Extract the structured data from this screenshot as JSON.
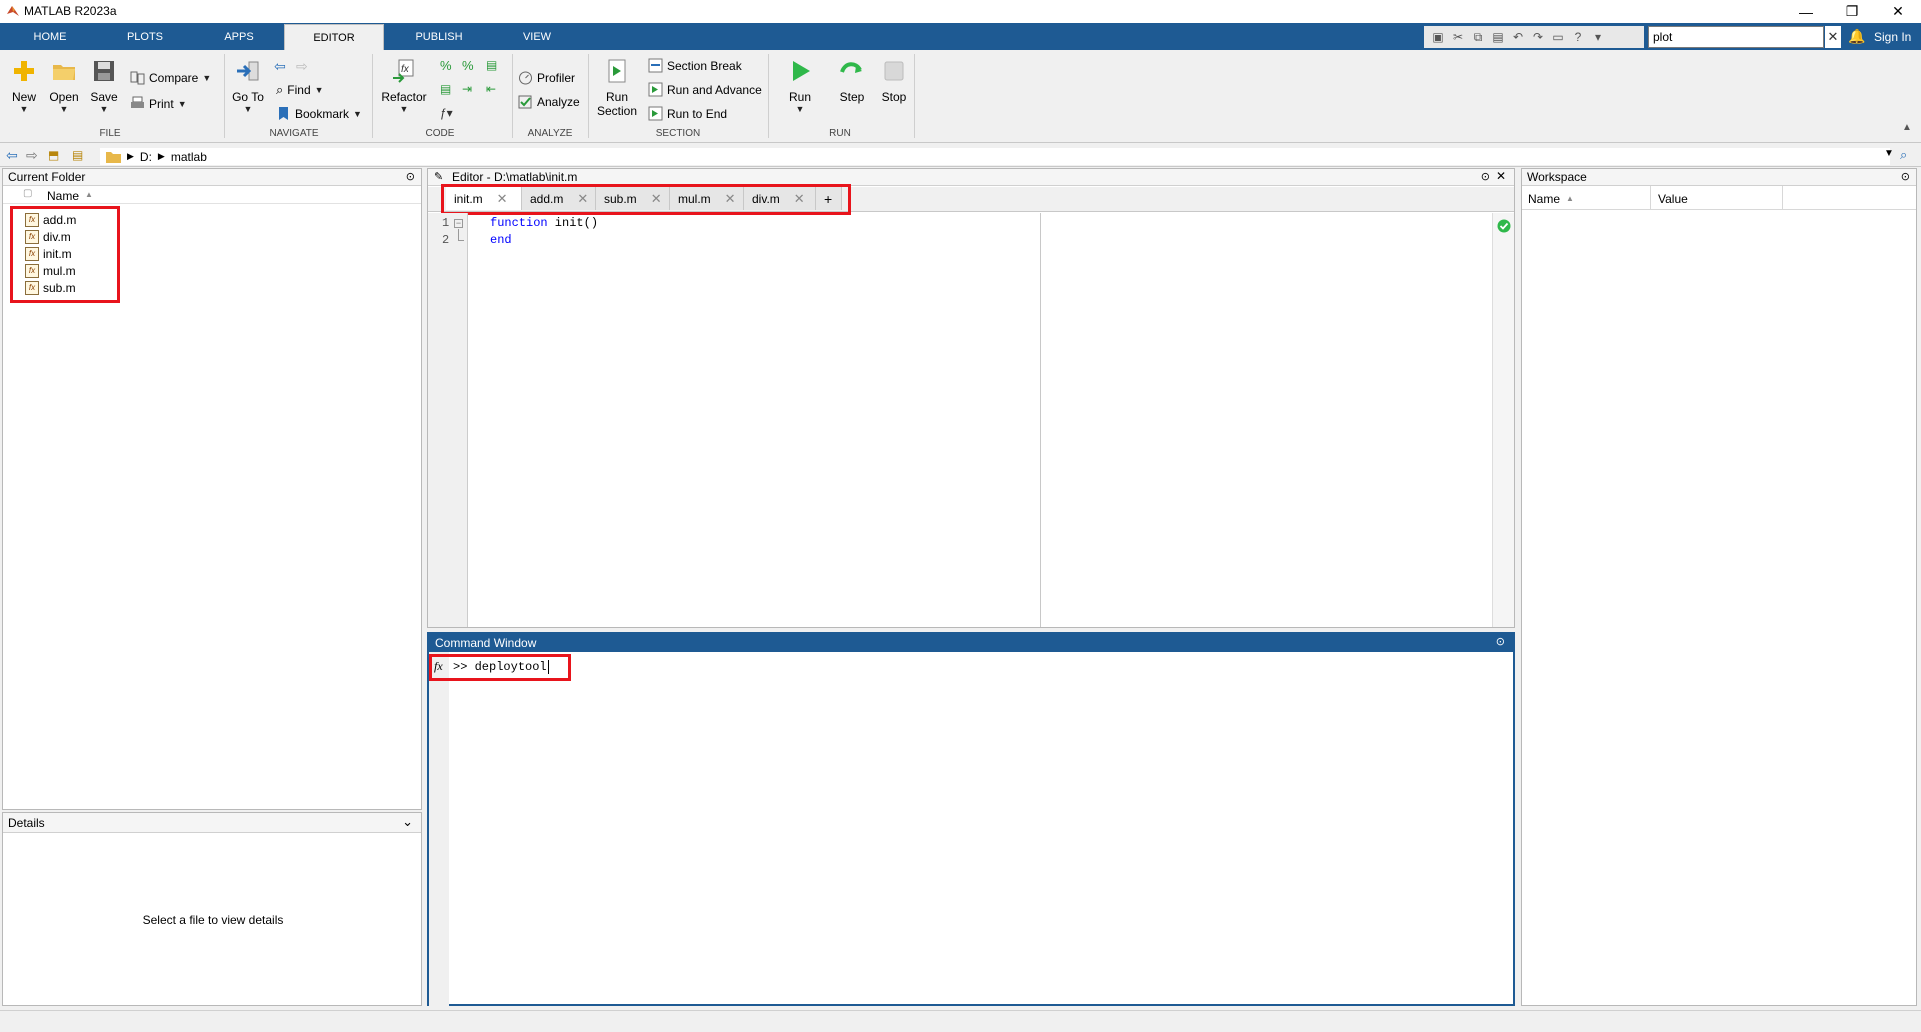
{
  "window": {
    "title": "MATLAB R2023a",
    "minimize": "—",
    "restore": "❐",
    "close": "✕"
  },
  "ribbon_tabs": [
    "HOME",
    "PLOTS",
    "APPS",
    "EDITOR",
    "PUBLISH",
    "VIEW"
  ],
  "active_tab": "EDITOR",
  "search": {
    "value": "plot",
    "clear": "✕"
  },
  "sign_in": "Sign In",
  "toolstrip": {
    "file": {
      "label": "FILE",
      "new": "New",
      "open": "Open",
      "save": "Save",
      "compare": "Compare",
      "print": "Print"
    },
    "navigate": {
      "label": "NAVIGATE",
      "go_to": "Go To",
      "find": "Find",
      "bookmark": "Bookmark"
    },
    "code": {
      "label": "CODE",
      "refactor": "Refactor"
    },
    "analyze": {
      "label": "ANALYZE",
      "profiler": "Profiler",
      "analyze": "Analyze"
    },
    "section": {
      "label": "SECTION",
      "run_section_1": "Run",
      "run_section_2": "Section",
      "section_break": "Section Break",
      "run_and_advance": "Run and Advance",
      "run_to_end": "Run to End"
    },
    "run": {
      "label": "RUN",
      "run": "Run",
      "step": "Step",
      "stop": "Stop"
    }
  },
  "address": {
    "drive": "D:",
    "folder": "matlab"
  },
  "current_folder": {
    "title": "Current Folder",
    "column": "Name",
    "files": [
      "add.m",
      "div.m",
      "init.m",
      "mul.m",
      "sub.m"
    ]
  },
  "details": {
    "title": "Details",
    "message": "Select a file to view details"
  },
  "editor": {
    "title": "Editor - D:\\matlab\\init.m",
    "tabs": [
      "init.m",
      "add.m",
      "sub.m",
      "mul.m",
      "div.m"
    ],
    "add_tab": "+",
    "line_numbers": [
      "1",
      "2"
    ],
    "code_keyword_1": "function",
    "code_rest_1": " init()",
    "code_line_2": "end"
  },
  "command_window": {
    "title": "Command Window",
    "prompt": ">>",
    "command": "deploytool",
    "fx": "fx"
  },
  "workspace": {
    "title": "Workspace",
    "col_name": "Name",
    "col_value": "Value"
  },
  "colors": {
    "ribbon_blue": "#1e5a93",
    "highlight_red": "#e8141c",
    "keyword_blue": "#0000ff"
  }
}
